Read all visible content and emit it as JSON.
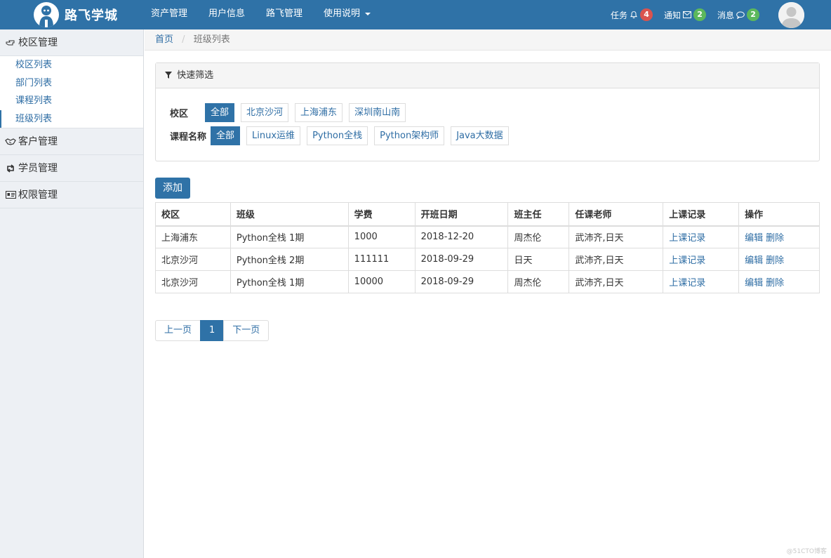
{
  "brand": {
    "title": "路飞学城",
    "logo_icon": "student-mascot-icon"
  },
  "nav": {
    "items": [
      "资产管理",
      "用户信息",
      "路飞管理"
    ],
    "dropdown_label": "使用说明",
    "tasks": {
      "label": "任务",
      "icon": "bell-icon",
      "count": "4",
      "color": "#d9534f"
    },
    "notices": {
      "label": "通知",
      "icon": "envelope-icon",
      "count": "2",
      "color": "#5cb85c"
    },
    "messages": {
      "label": "消息",
      "icon": "comment-icon",
      "count": "2",
      "color": "#5cb85c"
    }
  },
  "sidebar": {
    "groups": [
      {
        "label": "校区管理",
        "icon": "hand-point-icon",
        "items": [
          "校区列表",
          "部门列表",
          "课程列表",
          "班级列表"
        ]
      },
      {
        "label": "客户管理",
        "icon": "handshake-icon"
      },
      {
        "label": "学员管理",
        "icon": "retweet-icon"
      },
      {
        "label": "权限管理",
        "icon": "id-card-icon"
      }
    ]
  },
  "breadcrumb": {
    "home": "首页",
    "current": "班级列表"
  },
  "filter": {
    "title": "快速筛选",
    "campus": {
      "label": "校区",
      "options": [
        "全部",
        "北京沙河",
        "上海浦东",
        "深圳南山南"
      ]
    },
    "course": {
      "label": "课程名称",
      "options": [
        "全部",
        "Linux运维",
        "Python全栈",
        "Python架构师",
        "Java大数据"
      ]
    }
  },
  "add_label": "添加",
  "table": {
    "headers": [
      "校区",
      "班级",
      "学费",
      "开班日期",
      "班主任",
      "任课老师",
      "上课记录",
      "操作"
    ],
    "rows": [
      {
        "campus": "上海浦东",
        "class": "Python全栈 1期",
        "fee": "1000",
        "start": "2018-12-20",
        "head": "周杰伦",
        "teachers": "武沛齐,日天",
        "record": "上课记录",
        "edit": "编辑",
        "del": "删除"
      },
      {
        "campus": "北京沙河",
        "class": "Python全栈 2期",
        "fee": "111111",
        "start": "2018-09-29",
        "head": "日天",
        "teachers": "武沛齐,日天",
        "record": "上课记录",
        "edit": "编辑",
        "del": "删除"
      },
      {
        "campus": "北京沙河",
        "class": "Python全栈 1期",
        "fee": "10000",
        "start": "2018-09-29",
        "head": "周杰伦",
        "teachers": "武沛齐,日天",
        "record": "上课记录",
        "edit": "编辑",
        "del": "删除"
      }
    ]
  },
  "pagination": {
    "prev": "上一页",
    "current": "1",
    "next": "下一页"
  },
  "watermark": "@51CTO博客",
  "colors": {
    "primary": "#2f72a7",
    "link": "#2e6da4",
    "danger_badge": "#d9534f",
    "success_badge": "#5cb85c"
  }
}
